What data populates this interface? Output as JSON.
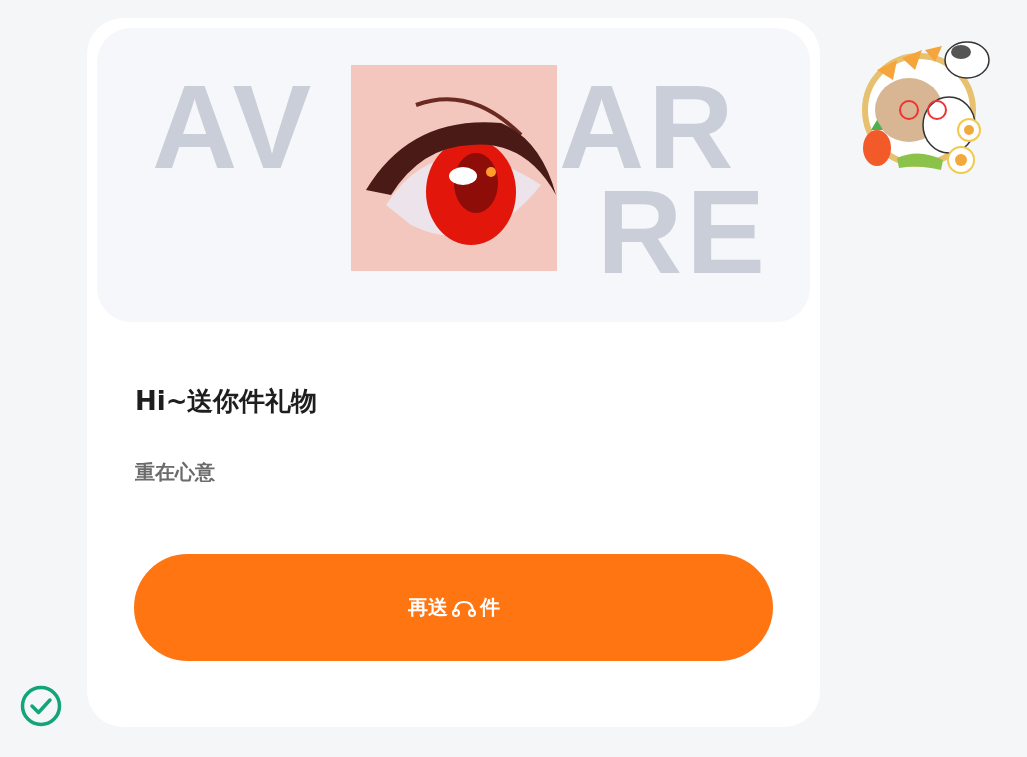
{
  "banner": {
    "background_words": [
      "AV",
      "AR",
      "RE"
    ]
  },
  "title": "Hi~送你件礼物",
  "subtitle": "重在心意",
  "button": {
    "label_before_icon": "再送",
    "label_after_icon": "件"
  }
}
